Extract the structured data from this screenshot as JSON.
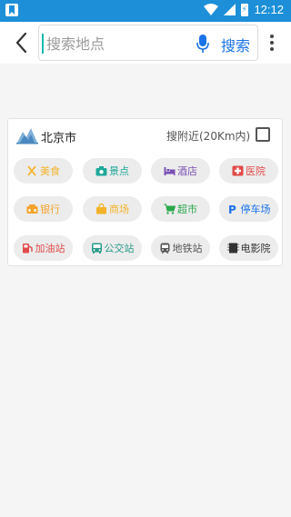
{
  "status_bar": {
    "time": "12:12"
  },
  "search": {
    "placeholder": "搜索地点",
    "button_label": "搜索"
  },
  "card": {
    "city": "北京市",
    "nearby_label": "搜附近(20Km内)",
    "categories": [
      {
        "label": "美食",
        "icon": "food-icon",
        "color": "#f2b32a"
      },
      {
        "label": "景点",
        "icon": "camera-icon",
        "color": "#1fa89a"
      },
      {
        "label": "酒店",
        "icon": "bed-icon",
        "color": "#7a4fb6"
      },
      {
        "label": "医院",
        "icon": "hospital-icon",
        "color": "#e24a4a"
      },
      {
        "label": "银行",
        "icon": "bank-icon",
        "color": "#f2a32a"
      },
      {
        "label": "商场",
        "icon": "shopping-bag-icon",
        "color": "#f2b32a"
      },
      {
        "label": "超市",
        "icon": "cart-icon",
        "color": "#2aa84a"
      },
      {
        "label": "停车场",
        "icon": "parking-icon",
        "color": "#1a73e8"
      },
      {
        "label": "加油站",
        "icon": "gas-station-icon",
        "color": "#e24a4a"
      },
      {
        "label": "公交站",
        "icon": "bus-icon",
        "color": "#2a9a8a"
      },
      {
        "label": "地铁站",
        "icon": "subway-icon",
        "color": "#555555"
      },
      {
        "label": "电影院",
        "icon": "film-icon",
        "color": "#333333"
      }
    ]
  },
  "colors": {
    "status_bar": "#1c8fd8",
    "accent": "#1a73e8",
    "cursor": "#14b8b0"
  }
}
